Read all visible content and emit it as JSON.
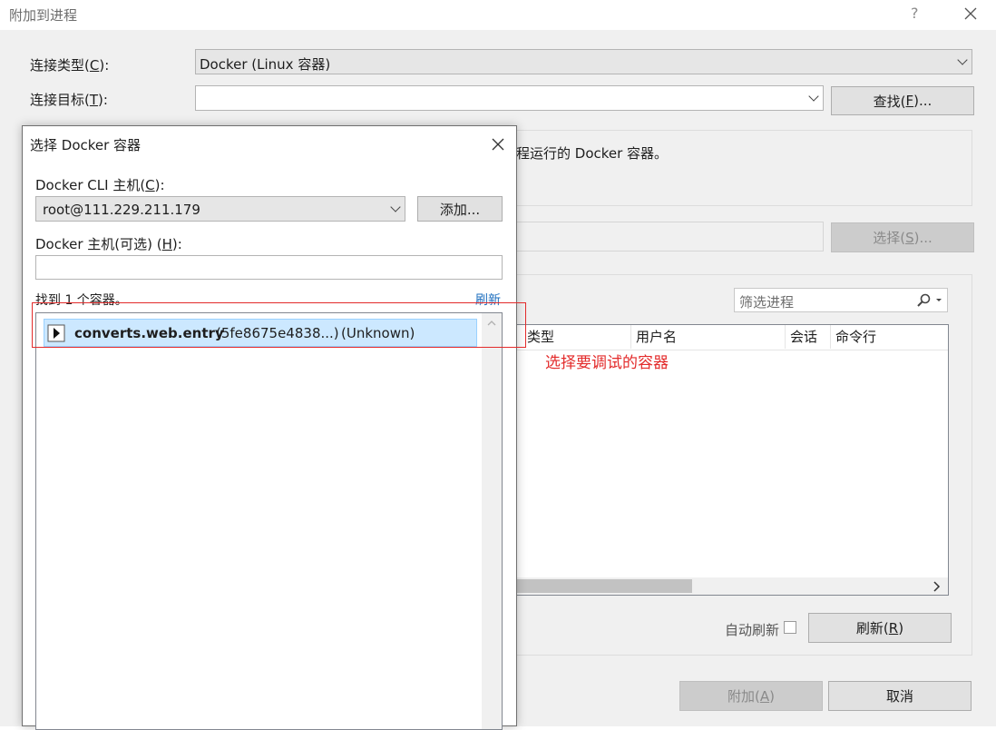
{
  "window": {
    "title": "附加到进程",
    "help": "?"
  },
  "connection": {
    "type_label_pre": "连接类型(",
    "type_label_key": "C",
    "type_label_post": "):",
    "type_value": "Docker (Linux 容器)",
    "target_label_pre": "连接目标(",
    "target_label_key": "T",
    "target_label_post": "):",
    "target_value": "",
    "find_pre": "查找(",
    "find_key": "F",
    "find_post": ")...",
    "info_text": "程运行的 Docker 容器。",
    "select_pre": "选择(",
    "select_key": "S",
    "select_post": ")..."
  },
  "processes": {
    "filter_placeholder": "筛选进程",
    "columns": [
      "类型",
      "用户名",
      "会话",
      "命令行"
    ],
    "auto_refresh_label": "自动刷新",
    "auto_refresh_checked": false,
    "refresh_pre": "刷新(",
    "refresh_key": "R",
    "refresh_post": ")"
  },
  "footer": {
    "attach_pre": "附加(",
    "attach_key": "A",
    "attach_post": ")",
    "cancel": "取消"
  },
  "dialog": {
    "title": "选择 Docker 容器",
    "cli_host_label_pre": "Docker CLI 主机(",
    "cli_host_label_key": "C",
    "cli_host_label_post": "):",
    "cli_host_value": "root@111.229.211.179",
    "add_button": "添加...",
    "host_label_pre": "Docker 主机(可选) (",
    "host_label_key": "H",
    "host_label_post": "):",
    "host_value": "",
    "found_text": "找到 1 个容器。",
    "refresh_link": "刷新",
    "containers": [
      {
        "name": "converts.web.entry",
        "id": "(5fe8675e4838...)",
        "status": "(Unknown)"
      }
    ]
  },
  "annotation": {
    "text": "选择要调试的容器",
    "color": "#e32b2b"
  }
}
